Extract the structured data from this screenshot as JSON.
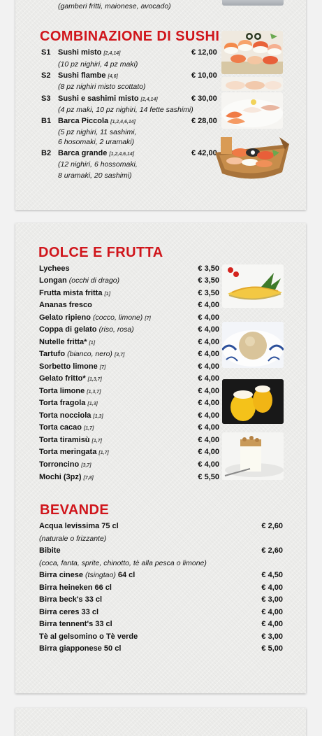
{
  "top_note": "(gamberi fritti, maionese, avocado)",
  "sushi": {
    "title": "COMBINAZIONE DI SUSHI",
    "items": [
      {
        "code": "S1",
        "name": "Sushi misto",
        "allergens": "[2,4,14]",
        "price": "€ 12,00",
        "desc": [
          "(10 pz nighiri, 4 pz maki)"
        ]
      },
      {
        "code": "S2",
        "name": "Sushi flambe",
        "allergens": "[4,6]",
        "price": "€ 10,00",
        "desc": [
          "(8 pz nighiri misto scottato)"
        ]
      },
      {
        "code": "S3",
        "name": "Sushi e sashimi misto",
        "allergens": "[2,4,14]",
        "price": "€ 30,00",
        "desc": [
          "(4 pz maki, 10 pz nighiri, 14 fette sashimi)"
        ]
      },
      {
        "code": "B1",
        "name": "Barca Piccola",
        "allergens": "[1,2,4,6,14]",
        "price": "€ 28,00",
        "desc": [
          "(5 pz nighiri, 11 sashimi,",
          "6 hosomaki, 2 uramaki)"
        ]
      },
      {
        "code": "B2",
        "name": "Barca grande",
        "allergens": "[1,2,4,6,14]",
        "price": "€ 42,00",
        "desc": [
          "(12 nighiri, 6 hossomaki,",
          "8 uramaki, 20 sashimi)"
        ]
      }
    ]
  },
  "dolce": {
    "title": "DOLCE E FRUTTA",
    "items": [
      {
        "name": "Lychees",
        "sub": "",
        "allergens": "",
        "price": "€ 3,50"
      },
      {
        "name": "Longan",
        "sub": "(occhi di drago)",
        "allergens": "",
        "price": "€ 3,50"
      },
      {
        "name": "Frutta mista fritta",
        "sub": "",
        "allergens": "[1]",
        "price": "€ 3,50"
      },
      {
        "name": "Ananas fresco",
        "sub": "",
        "allergens": "",
        "price": "€ 4,00"
      },
      {
        "name": "Gelato ripieno",
        "sub": "(cocco, limone)",
        "allergens": "[7]",
        "price": "€ 4,00"
      },
      {
        "name": "Coppa di gelato",
        "sub": "(riso, rosa)",
        "allergens": "",
        "price": "€ 4,00"
      },
      {
        "name": "Nutelle fritta*",
        "sub": "",
        "allergens": "[1]",
        "price": "€ 4,00"
      },
      {
        "name": "Tartufo",
        "sub": "(bianco, nero)",
        "allergens": "[3,7]",
        "price": "€ 4,00"
      },
      {
        "name": "Sorbetto limone",
        "sub": "",
        "allergens": "[7]",
        "price": "€ 4,00"
      },
      {
        "name": "Gelato fritto*",
        "sub": "",
        "allergens": "[1,3,7]",
        "price": "€ 4,00"
      },
      {
        "name": "Torta limone",
        "sub": "",
        "allergens": "[1,3,7]",
        "price": "€ 4,00"
      },
      {
        "name": "Torta fragola",
        "sub": "",
        "allergens": "[1,3]",
        "price": "€ 4,00"
      },
      {
        "name": "Torta nocciola",
        "sub": "",
        "allergens": "[1,3]",
        "price": "€ 4,00"
      },
      {
        "name": "Torta cacao",
        "sub": "",
        "allergens": "[1,7]",
        "price": "€ 4,00"
      },
      {
        "name": "Torta tiramisù",
        "sub": "",
        "allergens": "[1,7]",
        "price": "€ 4,00"
      },
      {
        "name": "Torta meringata",
        "sub": "",
        "allergens": "[1,7]",
        "price": "€ 4,00"
      },
      {
        "name": "Torroncino",
        "sub": "",
        "allergens": "[3,7]",
        "price": "€ 4,00"
      },
      {
        "name": "Mochi (3pz)",
        "sub": "",
        "allergens": "[7,8]",
        "price": "€ 5,50"
      }
    ]
  },
  "bevande": {
    "title": "BEVANDE",
    "items": [
      {
        "name": "Acqua levissima 75 cl",
        "note": "(naturale o frizzante)",
        "price": "€ 2,60"
      },
      {
        "name": "Bibite",
        "note": "(coca, fanta, sprite, chinotto, tè alla pesca o limone)",
        "price": "€ 2,60"
      },
      {
        "name": "Birra cinese",
        "sub": "(tsingtao)",
        "suffix": "64 cl",
        "price": "€ 4,50"
      },
      {
        "name": "Birra heineken 66 cl",
        "price": "€ 4,00"
      },
      {
        "name": "Birra beck's 33 cl",
        "price": "€ 3,00"
      },
      {
        "name": "Birra ceres 33 cl",
        "price": "€ 4,00"
      },
      {
        "name": "Birra tennent's 33 cl",
        "price": "€ 4,00"
      },
      {
        "name": "Tè al gelsomino o Tè verde",
        "price": "€ 3,00"
      },
      {
        "name": "Birra giapponese 50 cl",
        "price": "€ 5,00"
      }
    ]
  },
  "colors": {
    "heading": "#d0151b",
    "text": "#111111",
    "paper": "#ececea"
  },
  "images": [
    "sushi-platter-photo",
    "nigiri-plate-photo",
    "sashimi-plate-photo",
    "sushi-boat-photo",
    "pineapple-photo",
    "tartufo-photo",
    "stuffed-lemon-photo",
    "meringue-cake-photo"
  ]
}
